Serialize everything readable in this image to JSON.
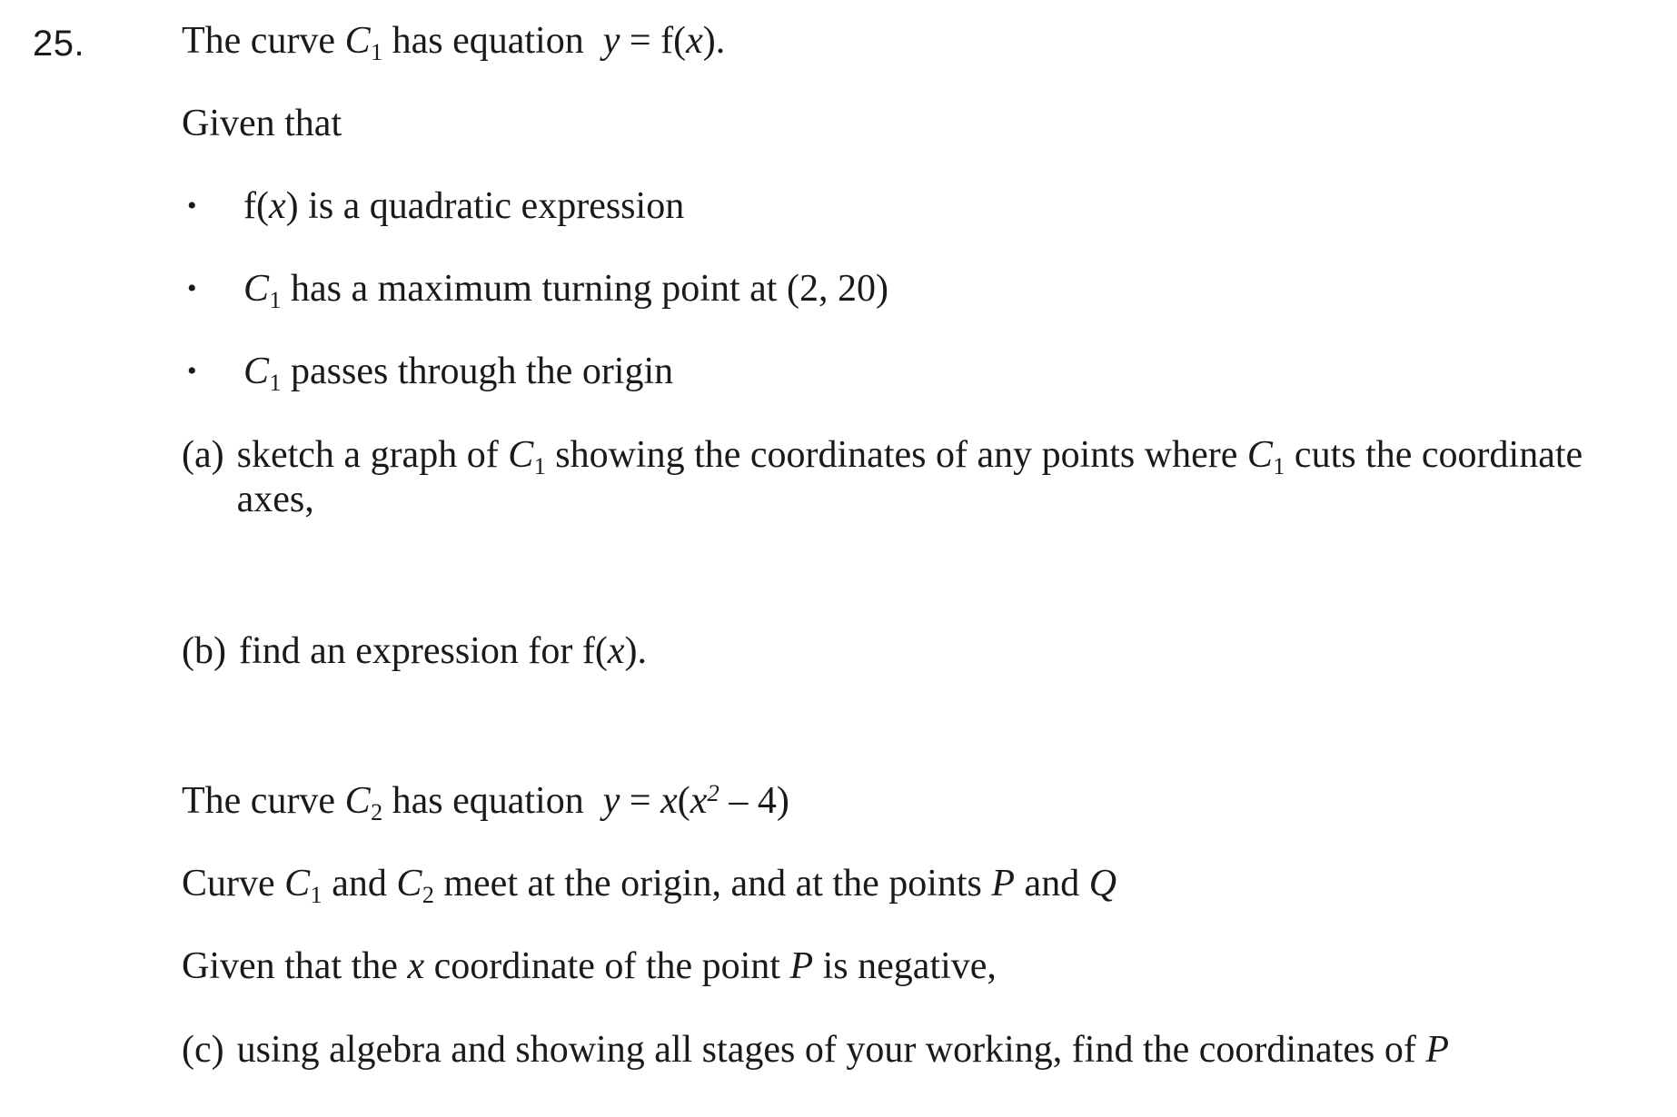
{
  "question": {
    "number": "25.",
    "intro_line": "The curve C1 has equation  y = f(x).",
    "given_heading": "Given that",
    "bullet_marker": "•",
    "bullets": [
      {
        "text": "f(x) is a quadratic expression"
      },
      {
        "text": "C1 has a maximum turning point at (2, 20)"
      },
      {
        "text": "C1 passes through the origin"
      }
    ],
    "parts": [
      {
        "label": "(a)",
        "text": "sketch a graph of C1 showing the coordinates of any points where C1 cuts the coordinate axes,"
      },
      {
        "label": "(b)",
        "text": "find an expression for f(x)."
      },
      {
        "label": "(c)",
        "text": "using algebra and showing all stages of your working, find the coordinates of P"
      }
    ],
    "c2_line": "The curve C2 has equation  y = x(x2 – 4)",
    "meet_line": "Curve C1 and C2 meet at the origin, and at the points P and Q",
    "negative_line": "Given that the x coordinate of the point P is negative,",
    "symbols": {
      "curve_c": "C",
      "sub_one": "1",
      "sub_two": "2",
      "function_f": "f",
      "var_x": "x",
      "var_y": "y",
      "point_p": "P",
      "point_q": "Q",
      "equals": "=",
      "minus": "–",
      "power_two": "2",
      "turning_point": "(2, 20)"
    },
    "fragments": {
      "the_curve": "The curve",
      "has_equation": "has equation",
      "is_quadratic": "is a quadratic expression",
      "has_max_tp": "has a maximum turning point at",
      "passes_origin": "passes through the origin",
      "a_sketch_1": "sketch a graph of",
      "a_sketch_2": "showing the coordinates of any points where",
      "a_sketch_3": "cuts the",
      "a_sketch_4": "coordinate axes,",
      "b_find": "find an expression for",
      "meet_curve": "Curve",
      "meet_and": "and",
      "meet_tail": "meet at the origin, and at the points",
      "meet_andq": "and",
      "neg_1": "Given that the",
      "neg_2": "coordinate of the point",
      "neg_3": "is negative,",
      "c_1": "using algebra and showing all stages of your working, find the coordinates of",
      "period": ".",
      "open_paren": "(",
      "close_paren": ")"
    }
  },
  "colors": {
    "page_background": "#ffffff",
    "text": "#1a1a1a"
  }
}
